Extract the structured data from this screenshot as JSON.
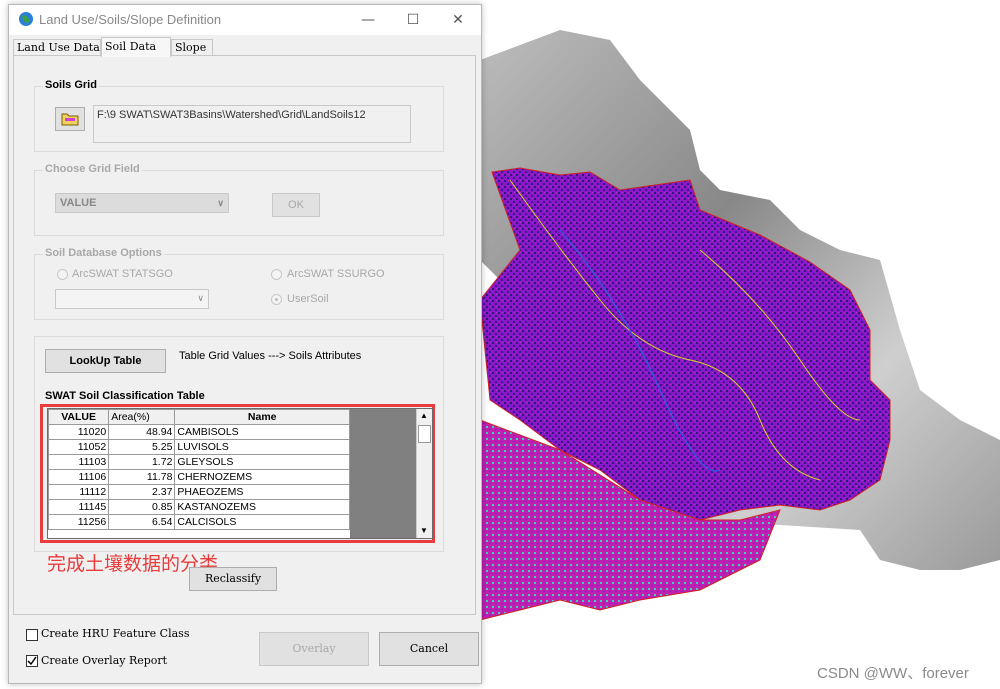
{
  "window": {
    "title": "Land Use/Soils/Slope Definition",
    "minimize": "—",
    "maximize": "☐",
    "close": "✕"
  },
  "tabs": [
    "Land Use Data",
    "Soil Data",
    "Slope"
  ],
  "soils_grid": {
    "label": "Soils Grid",
    "path": "F:\\9 SWAT\\SWAT3Basins\\Watershed\\Grid\\LandSoils12"
  },
  "choose_field": {
    "label": "Choose Grid Field",
    "selected": "VALUE",
    "ok_label": "OK"
  },
  "soil_db": {
    "label": "Soil Database Options",
    "opt_statsgo": "ArcSWAT STATSGO",
    "opt_ssurgo": "ArcSWAT SSURGO",
    "opt_usersoil": "UserSoil",
    "dropdown_value": ""
  },
  "lookup": {
    "button": "LookUp Table",
    "desc": "Table Grid Values ---> Soils Attributes"
  },
  "table": {
    "title": "SWAT Soil Classification Table",
    "headers": [
      "VALUE",
      "Area(%)",
      "Name"
    ],
    "rows": [
      [
        "11020",
        "48.94",
        "CAMBISOLS"
      ],
      [
        "11052",
        "5.25",
        "LUVISOLS"
      ],
      [
        "11103",
        "1.72",
        "GLEYSOLS"
      ],
      [
        "11106",
        "11.78",
        "CHERNOZEMS"
      ],
      [
        "11112",
        "2.37",
        "PHAEOZEMS"
      ],
      [
        "11145",
        "0.85",
        "KASTANOZEMS"
      ],
      [
        "11256",
        "6.54",
        "CALCISOLS"
      ]
    ]
  },
  "annotation": "完成土壤数据的分类",
  "reclassify_button": "Reclassify",
  "create_hru": {
    "label": "Create HRU Feature Class",
    "checked": false
  },
  "create_report": {
    "label": "Create Overlay Report",
    "checked": true
  },
  "overlay_button": "Overlay",
  "cancel_button": "Cancel",
  "watermark": "CSDN @WW、forever",
  "colors": {
    "annotation_red": "#e83b3b",
    "map_purple": "#a020d8",
    "map_navy": "#2a1a7a",
    "map_magenta": "#c020b0",
    "map_cyan": "#40d0c0"
  }
}
